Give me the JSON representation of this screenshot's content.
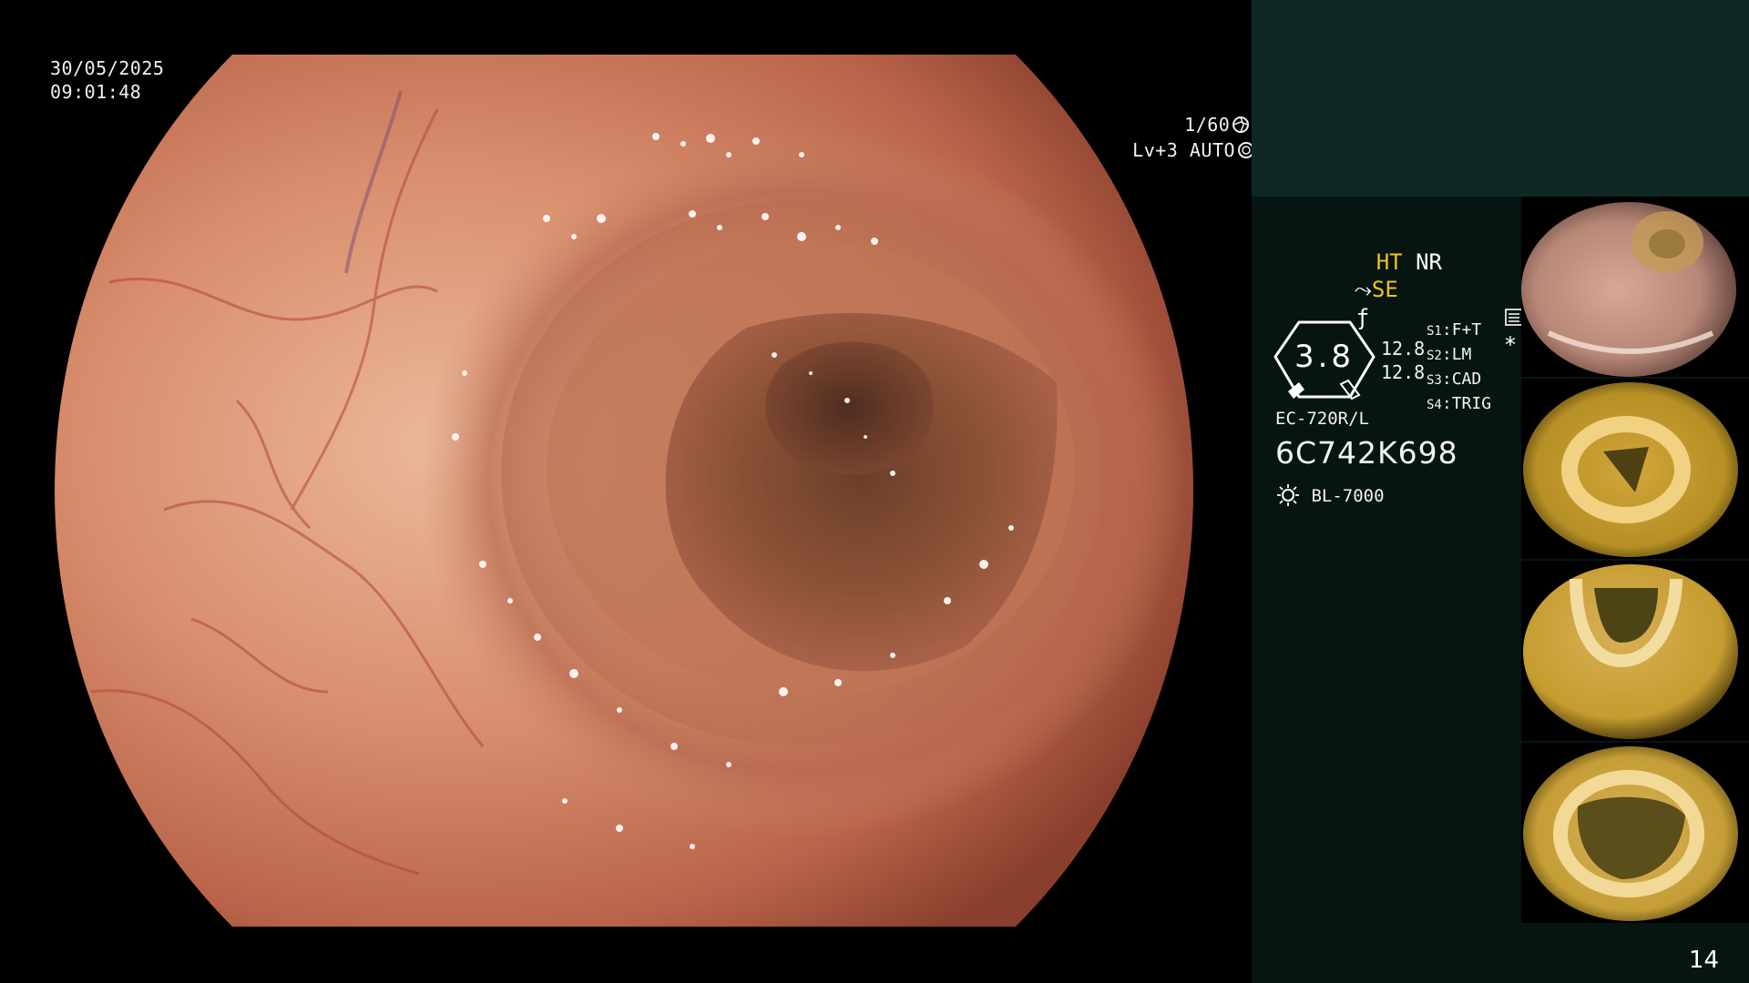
{
  "overlay": {
    "date": "30/05/2025",
    "time": "09:01:48",
    "shutter": "1/60",
    "level": "Lv+3 AUTO"
  },
  "panel": {
    "ht": "HT",
    "nr": "NR",
    "se": "SE",
    "f_symbol": "ƒ",
    "asterisk": "*",
    "gauge_value": "3.8",
    "gauge_side_values": [
      "12.8",
      "12.8"
    ],
    "switches": [
      {
        "key": "S1",
        "value": "F+T"
      },
      {
        "key": "S2",
        "value": "LM"
      },
      {
        "key": "S3",
        "value": "CAD"
      },
      {
        "key": "S4",
        "value": "TRIG"
      }
    ],
    "scope_model": "EC-720R/L",
    "serial": "6C742K698",
    "light_source": "BL-7000"
  },
  "thumbnails": [
    {
      "id": "thumb-1",
      "tint": "#c89a86"
    },
    {
      "id": "thumb-2",
      "tint": "#b68f25"
    },
    {
      "id": "thumb-3",
      "tint": "#c59c2f"
    },
    {
      "id": "thumb-4",
      "tint": "#c49d35"
    }
  ],
  "page_number": "14",
  "colors": {
    "panel_bg": "#061512",
    "panel_top": "#0f2826",
    "accent_yellow": "#f2c01e",
    "mucosa": "#d7906e"
  },
  "icons": [
    "shutter-icon",
    "auto-exposure-icon",
    "se-icon",
    "enhance-icon",
    "memo-icon",
    "light-source-icon"
  ]
}
